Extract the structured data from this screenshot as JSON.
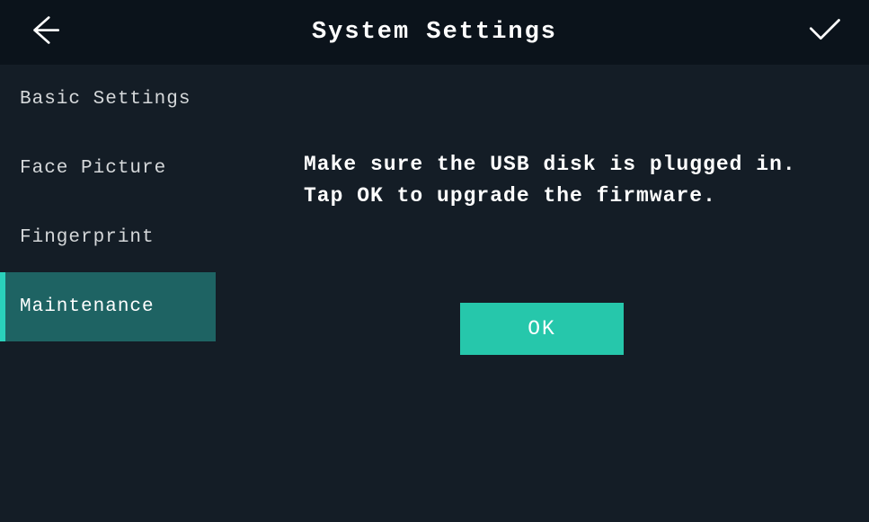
{
  "header": {
    "title": "System Settings"
  },
  "sidebar": {
    "items": [
      {
        "label": "Basic Settings",
        "active": false
      },
      {
        "label": "Face Picture",
        "active": false
      },
      {
        "label": "Fingerprint",
        "active": false
      },
      {
        "label": "Maintenance",
        "active": true
      }
    ]
  },
  "main": {
    "message": "Make sure the USB disk is plugged in. Tap OK to upgrade the firmware.",
    "ok_label": "OK"
  }
}
